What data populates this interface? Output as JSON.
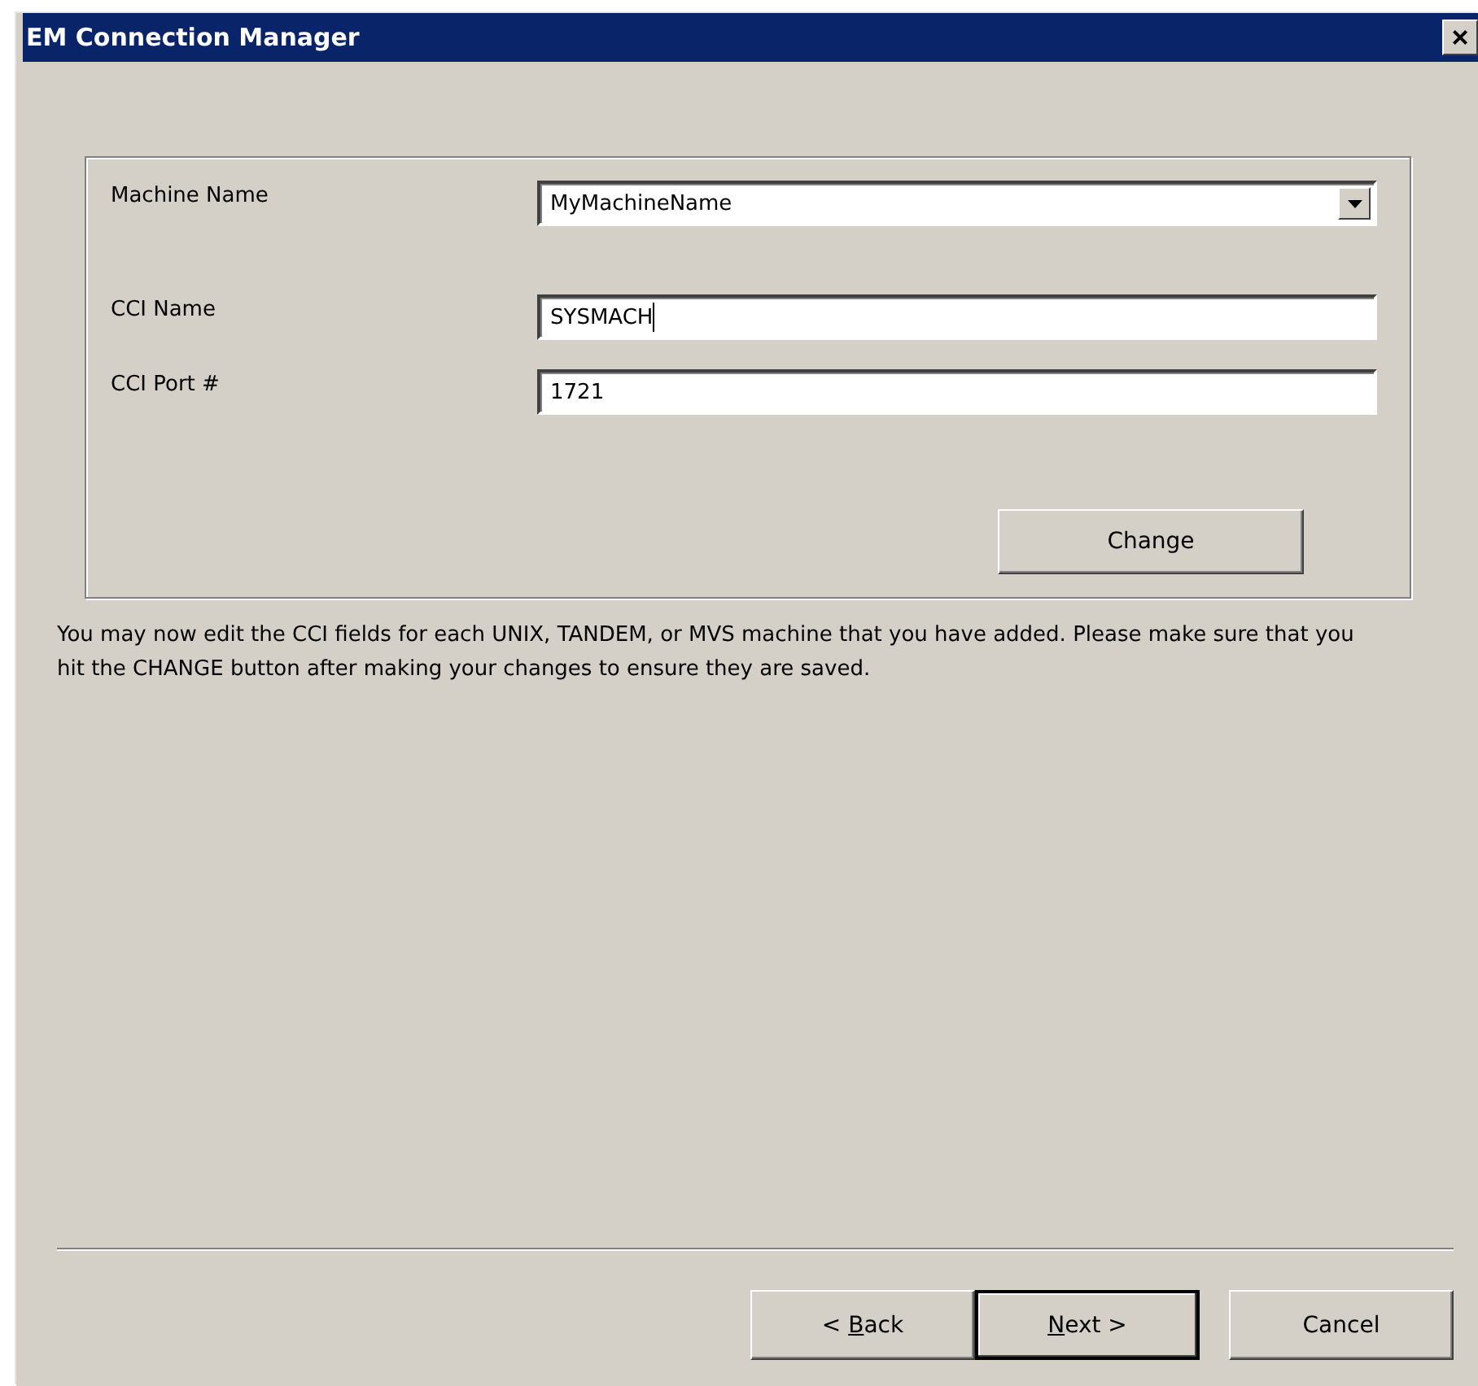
{
  "window": {
    "title": "EM Connection Manager",
    "close": "×"
  },
  "form": {
    "fields": [
      {
        "label": "Machine Name",
        "value": "MyMachineName",
        "kind": "dropdown",
        "focused": false
      },
      {
        "label": "CCI Name",
        "value": "SYSMACH",
        "kind": "text",
        "focused": true
      },
      {
        "label": "CCI Port #",
        "value": "1721",
        "kind": "text",
        "focused": false
      }
    ],
    "change_button": "Change"
  },
  "description": "You may now edit the CCI fields for each UNIX, TANDEM, or MVS machine that you have added.  Please make sure that you hit the CHANGE button after making your changes to ensure they are saved.",
  "buttons": [
    {
      "before": "< ",
      "key": "B",
      "after": "ack",
      "default": false,
      "kind": "back"
    },
    {
      "key": "N",
      "after": "ext >",
      "default": true,
      "kind": "next"
    },
    {
      "before": "Cancel",
      "default": false,
      "kind": "cancel"
    }
  ]
}
